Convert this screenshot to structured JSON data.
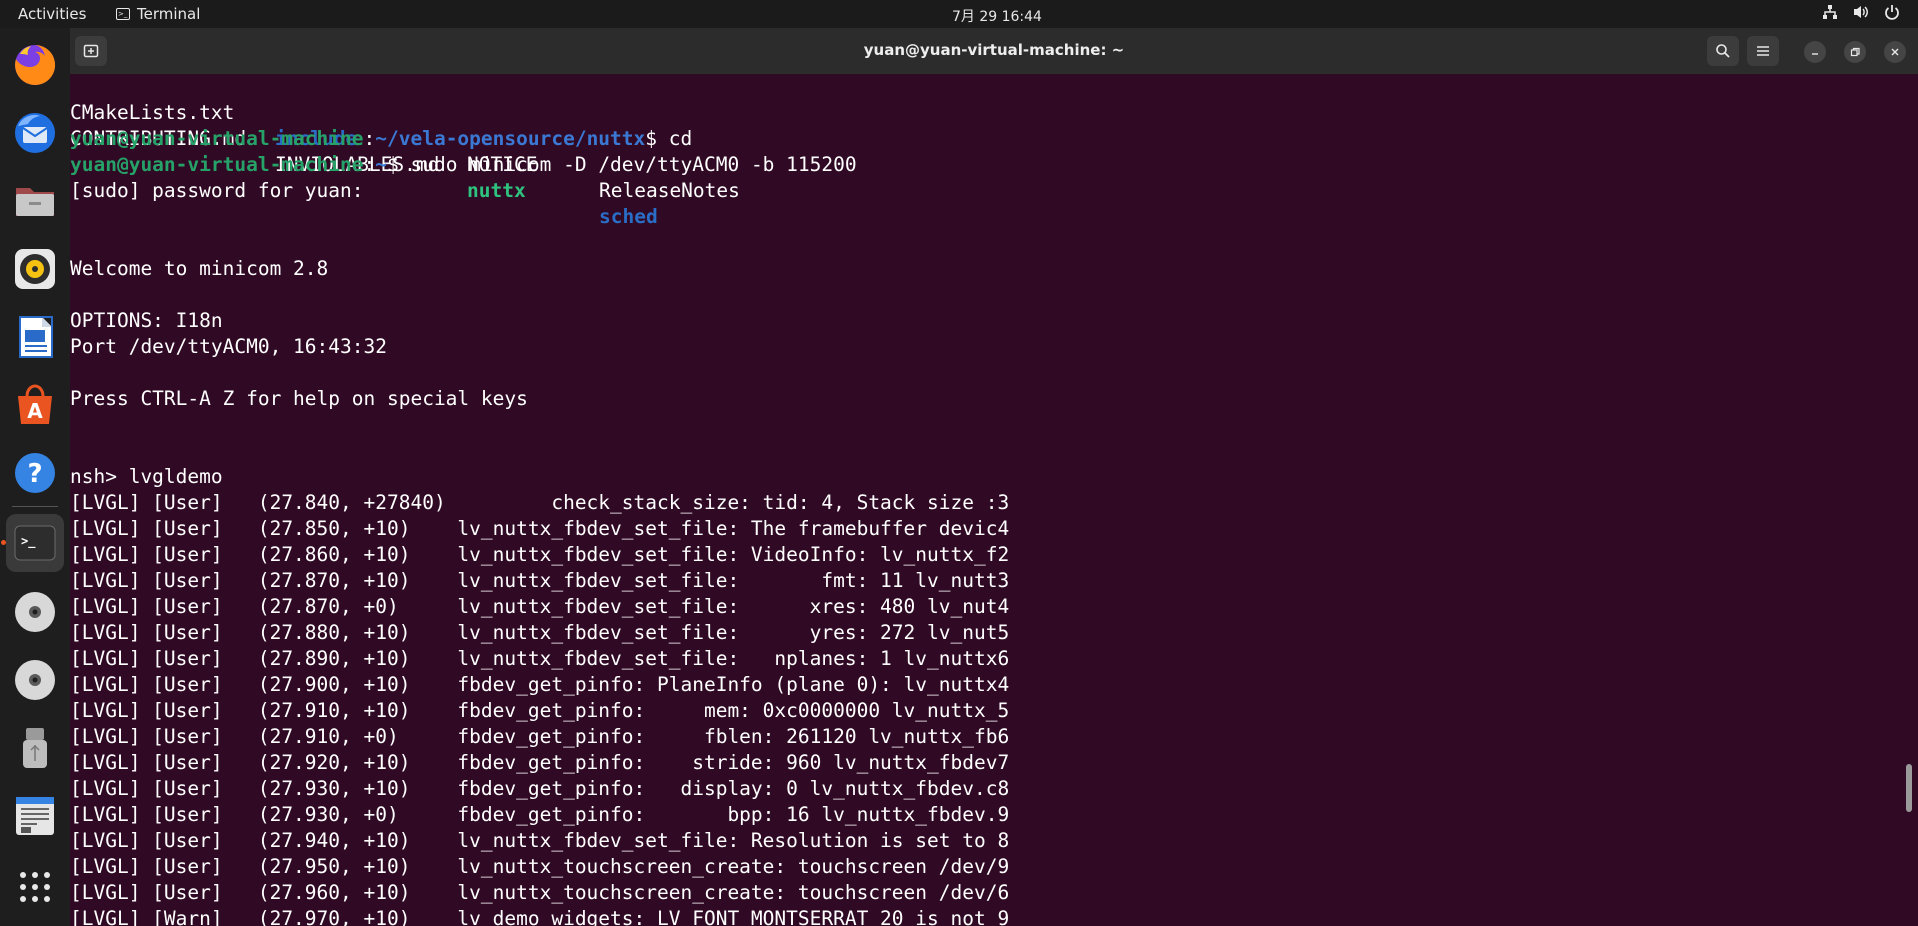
{
  "topbar": {
    "activities": "Activities",
    "app_name": "Terminal",
    "clock": "7月 29  16:44"
  },
  "window": {
    "title": "yuan@yuan-virtual-machine: ~"
  },
  "dock": {
    "items": [
      {
        "name": "firefox-icon",
        "active": false
      },
      {
        "name": "thunderbird-icon",
        "active": false
      },
      {
        "name": "files-icon",
        "active": false
      },
      {
        "name": "rhythmbox-icon",
        "active": false
      },
      {
        "name": "libreoffice-writer-icon",
        "active": false
      },
      {
        "name": "app-center-icon",
        "active": false
      },
      {
        "name": "help-icon",
        "active": false
      },
      {
        "name": "terminal-icon",
        "active": true
      },
      {
        "name": "disc-icon",
        "active": false
      },
      {
        "name": "disc-icon",
        "active": false
      },
      {
        "name": "usb-drive-icon",
        "active": false
      },
      {
        "name": "text-editor-icon",
        "active": false
      },
      {
        "name": "app-grid-icon",
        "active": false
      }
    ]
  },
  "terminal": {
    "ls_row1": [
      "CMakeLists.txt",
      "include",
      "NOTICE",
      "ReleaseNotes"
    ],
    "ls_row2": [
      "CONTRIBUTING.md",
      "INVIOLABLES.md",
      "nuttx",
      "sched"
    ],
    "prompt_user": "yuan@yuan-virtual-machine",
    "prompt_path_1": "~/vela-opensource/nuttx",
    "cmd_1": "$ cd",
    "prompt_path_2": "~",
    "cmd_2": "$ sudo minicom -D /dev/ttyACM0 -b 115200",
    "lines": [
      "[sudo] password for yuan:",
      "",
      "",
      "Welcome to minicom 2.8",
      "",
      "OPTIONS: I18n",
      "Port /dev/ttyACM0, 16:43:32",
      "",
      "Press CTRL-A Z for help on special keys",
      "",
      "",
      "nsh> lvgldemo",
      "[LVGL] [User]   (27.840, +27840)         check_stack_size: tid: 4, Stack size :3",
      "[LVGL] [User]   (27.850, +10)    lv_nuttx_fbdev_set_file: The framebuffer devic4",
      "[LVGL] [User]   (27.860, +10)    lv_nuttx_fbdev_set_file: VideoInfo: lv_nuttx_f2",
      "[LVGL] [User]   (27.870, +10)    lv_nuttx_fbdev_set_file:       fmt: 11 lv_nutt3",
      "[LVGL] [User]   (27.870, +0)     lv_nuttx_fbdev_set_file:      xres: 480 lv_nut4",
      "[LVGL] [User]   (27.880, +10)    lv_nuttx_fbdev_set_file:      yres: 272 lv_nut5",
      "[LVGL] [User]   (27.890, +10)    lv_nuttx_fbdev_set_file:   nplanes: 1 lv_nuttx6",
      "[LVGL] [User]   (27.900, +10)    fbdev_get_pinfo: PlaneInfo (plane 0): lv_nuttx4",
      "[LVGL] [User]   (27.910, +10)    fbdev_get_pinfo:     mem: 0xc0000000 lv_nuttx_5",
      "[LVGL] [User]   (27.910, +0)     fbdev_get_pinfo:     fblen: 261120 lv_nuttx_fb6",
      "[LVGL] [User]   (27.920, +10)    fbdev_get_pinfo:    stride: 960 lv_nuttx_fbdev7",
      "[LVGL] [User]   (27.930, +10)    fbdev_get_pinfo:   display: 0 lv_nuttx_fbdev.c8",
      "[LVGL] [User]   (27.930, +0)     fbdev_get_pinfo:       bpp: 16 lv_nuttx_fbdev.9",
      "[LVGL] [User]   (27.940, +10)    lv_nuttx_fbdev_set_file: Resolution is set to 8",
      "[LVGL] [User]   (27.950, +10)    lv_nuttx_touchscreen_create: touchscreen /dev/9",
      "[LVGL] [User]   (27.960, +10)    lv_nuttx_touchscreen_create: touchscreen /dev/6",
      "[LVGL] [Warn]   (27.970, +10)    lv_demo_widgets: LV_FONT_MONTSERRAT_20 is not 9"
    ]
  },
  "colors": {
    "terminal_bg": "#300a24",
    "dir_blue": "#2a6dc7",
    "exec_green": "#2ec27e",
    "prompt_green": "#26a269",
    "active_indicator": "#e95420"
  }
}
